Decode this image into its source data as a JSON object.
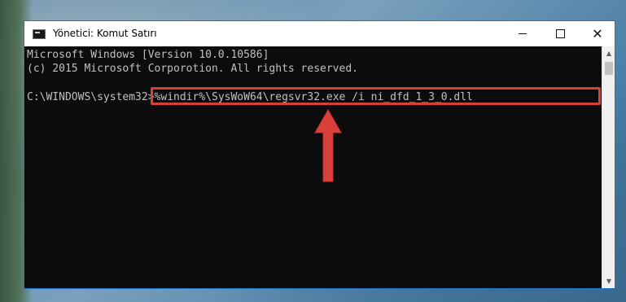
{
  "window": {
    "title": "Yönetici: Komut Satırı",
    "icon": "cmd-icon",
    "buttons": {
      "minimize": "minimize-icon",
      "maximize": "maximize-icon",
      "close": "close-icon"
    }
  },
  "console": {
    "line1": "Microsoft Windows [Version 10.0.10586]",
    "line2": "(c) 2015 Microsoft Corporotion. All rights reserved.",
    "prompt": "C:\\WINDOWS\\system32>",
    "command": "%windir%\\SysWoW64\\regsvr32.exe /i ni_dfd_1_3_0.dll"
  },
  "annotation": {
    "highlight_color": "#d9403a",
    "arrow_icon": "up-arrow-icon"
  },
  "scrollbar": {
    "up": "▲",
    "down": "▼"
  }
}
